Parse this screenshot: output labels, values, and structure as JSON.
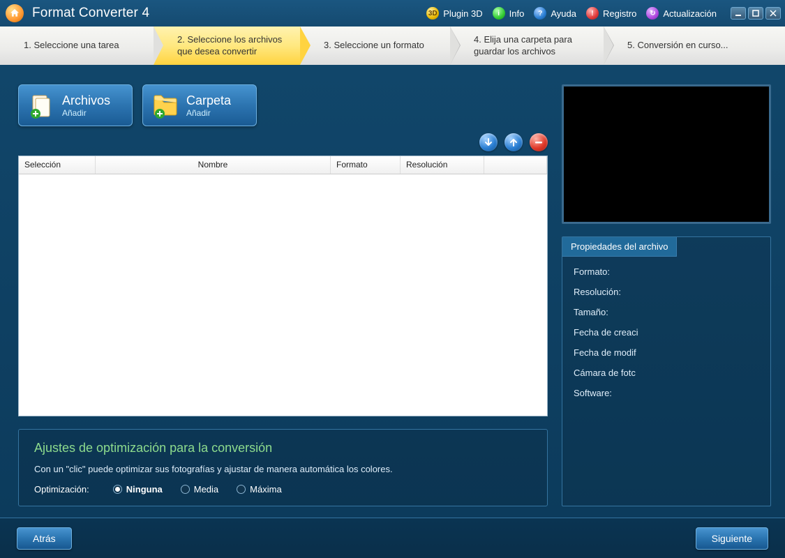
{
  "app": {
    "title": "Format Converter 4"
  },
  "menu": {
    "plugin3d": "Plugin 3D",
    "info": "Info",
    "help": "Ayuda",
    "register": "Registro",
    "update": "Actualización"
  },
  "steps": {
    "s1": "1. Seleccione una tarea",
    "s2a": "2. Seleccione los archivos",
    "s2b": "que desea convertir",
    "s3": "3. Seleccione un formato",
    "s4a": "4. Elija una carpeta para",
    "s4b": "guardar los archivos",
    "s5": "5. Conversión en curso..."
  },
  "buttons": {
    "files_title": "Archivos",
    "files_sub": "Añadir",
    "folder_title": "Carpeta",
    "folder_sub": "Añadir"
  },
  "table": {
    "selection": "Selección",
    "name": "Nombre",
    "format": "Formato",
    "resolution": "Resolución"
  },
  "optim": {
    "heading": "Ajustes de optimización para la conversión",
    "desc": "Con un \"clic\" puede optimizar sus fotografías y ajustar de manera automática los colores.",
    "label": "Optimización:",
    "none": "Ninguna",
    "medium": "Media",
    "max": "Máxima"
  },
  "props": {
    "tab": "Propiedades del archivo",
    "format": "Formato:",
    "resolution": "Resolución:",
    "size": "Tamaño:",
    "created": "Fecha de creaci",
    "modified": "Fecha de modif",
    "camera": "Cámara de fotc",
    "software": "Software:"
  },
  "nav": {
    "back": "Atrás",
    "next": "Siguiente"
  }
}
